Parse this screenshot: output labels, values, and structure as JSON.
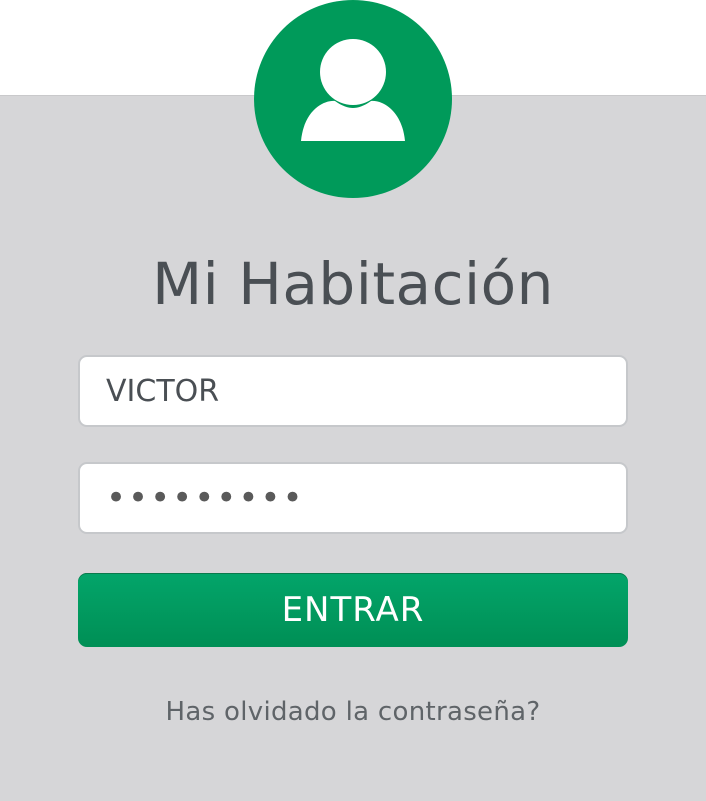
{
  "app": {
    "title": "Mi Habitación"
  },
  "avatar": {
    "icon": "user-icon",
    "color": "#009a5a"
  },
  "login": {
    "username_value": "VICTOR",
    "password_value": "•••••••••",
    "submit_label": "ENTRAR",
    "forgot_label": "Has olvidado la contraseña?"
  },
  "colors": {
    "background": "#d6d6d8",
    "accent": "#009a5a",
    "text": "#4a4f54"
  }
}
